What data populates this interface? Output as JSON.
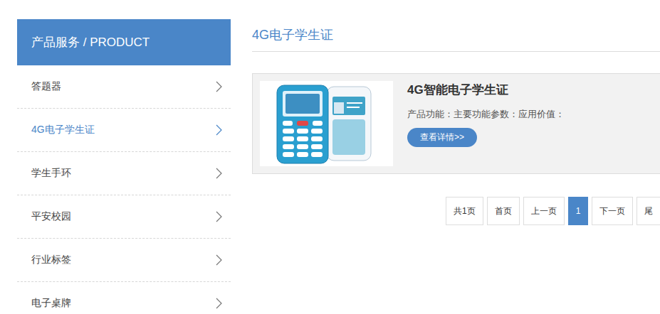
{
  "sidebar": {
    "title": "产品服务 / PRODUCT",
    "items": [
      {
        "label": "答题器",
        "selected": false
      },
      {
        "label": "4G电子学生证",
        "selected": true
      },
      {
        "label": "学生手环",
        "selected": false
      },
      {
        "label": "平安校园",
        "selected": false
      },
      {
        "label": "行业标签",
        "selected": false
      },
      {
        "label": "电子桌牌",
        "selected": false
      }
    ]
  },
  "content": {
    "title": "4G电子学生证",
    "products": [
      {
        "name": "4G智能电子学生证",
        "description": "产品功能：主要功能参数：应用价值：",
        "button": "查看详情>>"
      }
    ]
  },
  "pagination": [
    {
      "label": "共1页",
      "selected": false
    },
    {
      "label": "首页",
      "selected": false
    },
    {
      "label": "上一页",
      "selected": false
    },
    {
      "label": "1",
      "selected": true
    },
    {
      "label": "下一页",
      "selected": false
    },
    {
      "label": "尾",
      "selected": false
    }
  ]
}
